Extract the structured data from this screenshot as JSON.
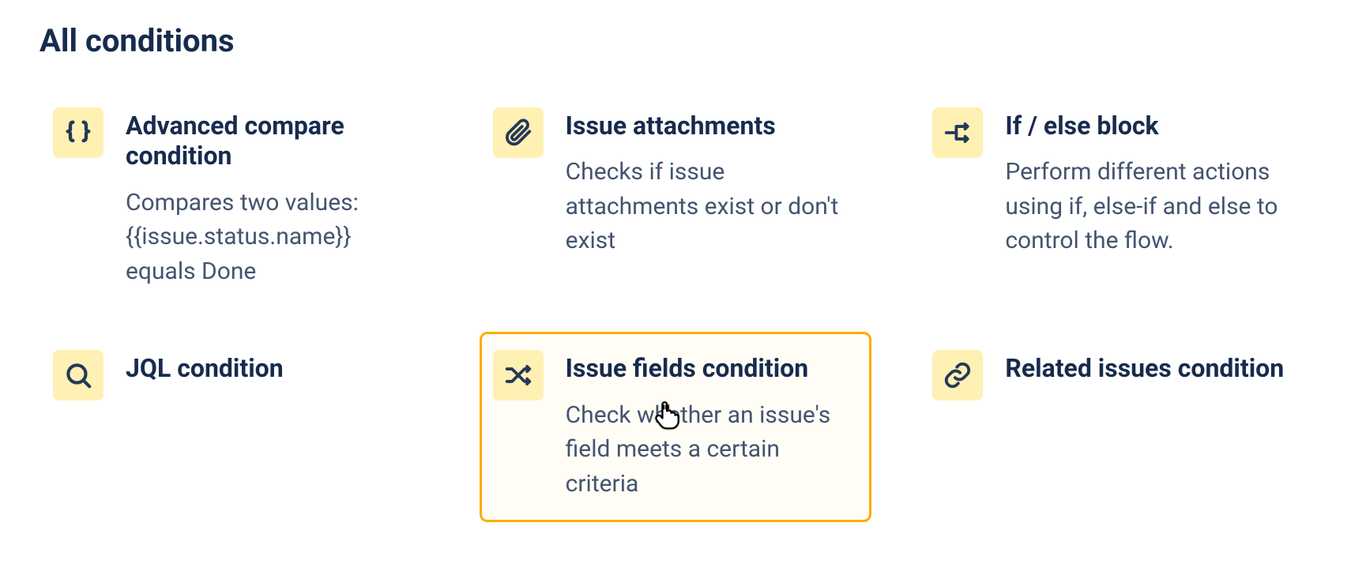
{
  "heading": "All conditions",
  "cards": [
    {
      "icon": "braces-icon",
      "title": "Advanced compare condition",
      "desc": "Compares two values: {{issue.status.name}} equals Done",
      "selected": false
    },
    {
      "icon": "branch-icon",
      "title": "If / else block",
      "desc": "Perform different actions using if, else-if and else to control the flow.",
      "selected": false
    },
    {
      "icon": "shuffle-icon",
      "title": "Issue fields condition",
      "desc": "Check whether an issue's field meets a certain criteria",
      "selected": true
    },
    {
      "icon": "clip-icon",
      "title": "Issue attachments",
      "desc": "Checks if issue attachments exist or don't exist",
      "selected": false
    },
    {
      "icon": "search-icon",
      "title": "JQL condition",
      "desc": "",
      "selected": false
    },
    {
      "icon": "link-icon",
      "title": "Related issues condition",
      "desc": "",
      "selected": false
    }
  ],
  "positions": [
    0,
    3,
    1,
    4,
    2,
    5
  ]
}
